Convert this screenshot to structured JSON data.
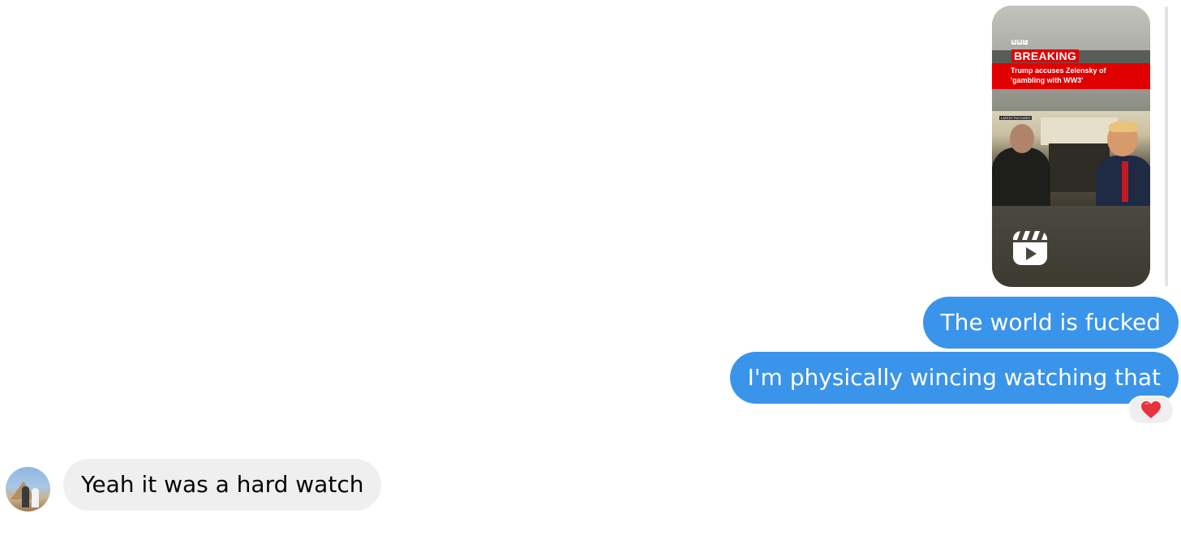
{
  "reel": {
    "news_brand": "BBC",
    "news_label": "BREAKING",
    "headline": "Trump accuses Zelensky of 'gambling with WW3'",
    "overlay_label": "LATEST PICTURES",
    "icon": "reel-play-icon"
  },
  "messages": [
    {
      "direction": "outgoing",
      "text": "The world is fucked"
    },
    {
      "direction": "outgoing",
      "text": "I'm physically wincing watching that",
      "reaction": "heart"
    },
    {
      "direction": "incoming",
      "text": "Yeah it was a hard watch"
    }
  ],
  "colors": {
    "outgoing_bubble": "#3a94ea",
    "incoming_bubble": "#efefef",
    "reaction_heart": "#e8323c",
    "breaking_red": "#e20000"
  }
}
